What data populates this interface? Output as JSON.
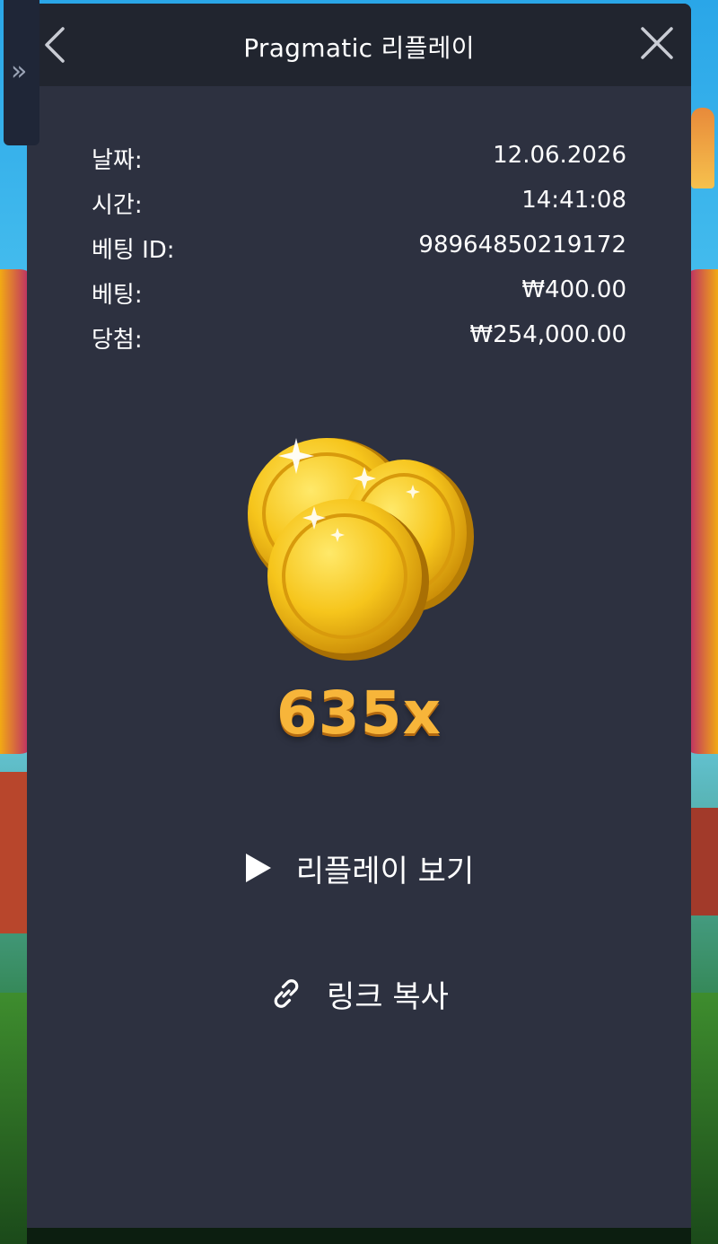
{
  "header": {
    "title": "Pragmatic 리플레이",
    "back_icon": "chevron-left-icon",
    "close_icon": "close-icon"
  },
  "side_tab": {
    "icon": "double-chevron-right-icon",
    "glyph": "»"
  },
  "details": [
    {
      "label": "날짜:",
      "value": "12.06.2026"
    },
    {
      "label": "시간:",
      "value": "14:41:08"
    },
    {
      "label": "베팅 ID:",
      "value": "98964850219172"
    },
    {
      "label": "베팅:",
      "value": "₩400.00"
    },
    {
      "label": "당첨:",
      "value": "₩254,000.00"
    }
  ],
  "result": {
    "icon": "gold-coins-icon",
    "multiplier": "635x"
  },
  "actions": {
    "replay": {
      "icon": "play-icon",
      "label": "리플레이 보기"
    },
    "copy_link": {
      "icon": "link-icon",
      "label": "링크 복사"
    }
  },
  "colors": {
    "panel_bg": "#2d3140",
    "header_bg": "#21252f",
    "multiplier": "#f7b53a"
  }
}
